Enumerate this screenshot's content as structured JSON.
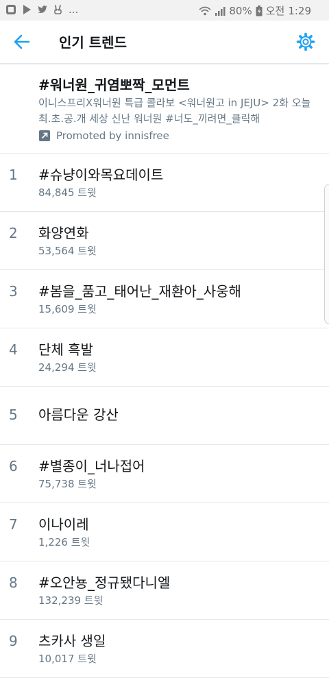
{
  "status_bar": {
    "dots": "...",
    "battery": "80%",
    "ampm": "오전",
    "time": "1:29"
  },
  "header": {
    "title": "인기 트렌드"
  },
  "promoted": {
    "tag": "#워너원_귀염뽀짝_모먼트",
    "description": "이니스프리X워너원 특급 콜라보 <워너원고 in JEJU> 2화 오늘 최.초.공.개 세상 신난 워너원 #너도_끼려면_클릭해",
    "promoted_by": "Promoted by innisfree"
  },
  "trends": [
    {
      "rank": "1",
      "name": "#슈냥이와목요데이트",
      "count": "84,845 트윗"
    },
    {
      "rank": "2",
      "name": "화양연화",
      "count": "53,564 트윗"
    },
    {
      "rank": "3",
      "name": "#봄을_품고_태어난_재환아_사웅해",
      "count": "15,609 트윗"
    },
    {
      "rank": "4",
      "name": "단체 흑발",
      "count": "24,294 트윗"
    },
    {
      "rank": "5",
      "name": "아름다운 강산",
      "count": ""
    },
    {
      "rank": "6",
      "name": "#별종이_너나접어",
      "count": "75,738 트윗"
    },
    {
      "rank": "7",
      "name": "이나이레",
      "count": "1,226 트윗"
    },
    {
      "rank": "8",
      "name": "#오안뇽_정규됐다니엘",
      "count": "132,239 트윗"
    },
    {
      "rank": "9",
      "name": "츠카사 생일",
      "count": "10,017 트윗"
    }
  ],
  "colors": {
    "accent": "#1da1f2",
    "secondary_text": "#657786",
    "primary_text": "#14171a",
    "divider": "#e1e8ed"
  }
}
